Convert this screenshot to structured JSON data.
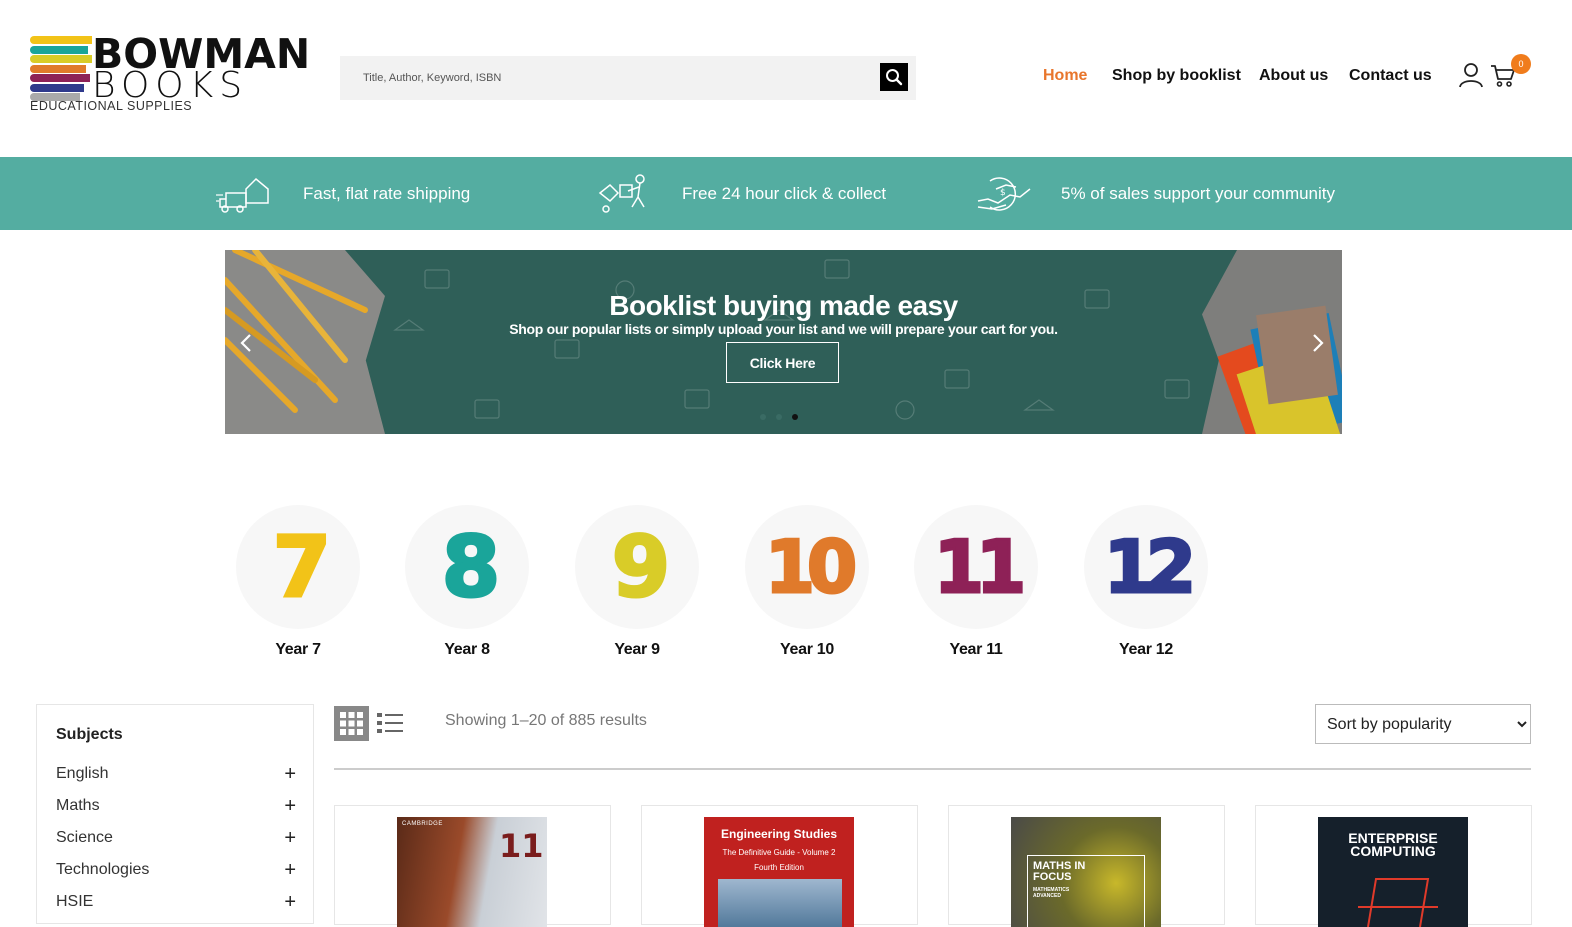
{
  "logo": {
    "word1": "BOWMAN",
    "word2": "BOOKS",
    "sub": "EDUCATIONAL SUPPLIES"
  },
  "search": {
    "placeholder": "Title, Author, Keyword, ISBN"
  },
  "nav": {
    "items": [
      "Home",
      "Shop by booklist",
      "About us",
      "Contact us"
    ],
    "active": "Home"
  },
  "cart": {
    "count": "0"
  },
  "features": [
    {
      "icon": "shipping-truck-icon",
      "text": "Fast, flat rate shipping"
    },
    {
      "icon": "click-collect-icon",
      "text": "Free 24 hour click & collect"
    },
    {
      "icon": "community-handshake-icon",
      "text": "5% of sales support your community"
    }
  ],
  "banner": {
    "title": "Booklist buying made easy",
    "subtitle": "Shop our popular lists or simply upload your list and we will prepare your cart for you.",
    "button": "Click Here",
    "slide_count": 3,
    "active_slide": 3
  },
  "years": [
    {
      "num": "7",
      "label": "Year 7",
      "color": "#f2c318"
    },
    {
      "num": "8",
      "label": "Year 8",
      "color": "#1aa59a"
    },
    {
      "num": "9",
      "label": "Year 9",
      "color": "#d9cc28"
    },
    {
      "num": "10",
      "label": "Year 10",
      "color": "#e07a2b"
    },
    {
      "num": "11",
      "label": "Year 11",
      "color": "#8e2157"
    },
    {
      "num": "12",
      "label": "Year 12",
      "color": "#2f3a8c"
    }
  ],
  "sidebar": {
    "title": "Subjects",
    "items": [
      "English",
      "Maths",
      "Science",
      "Technologies",
      "HSIE"
    ]
  },
  "toolbar": {
    "results": "Showing 1–20 of 885 results",
    "sort_selected": "Sort by popularity"
  },
  "products": [
    {
      "publisher": "CAMBRIDGE",
      "cover_text": "11",
      "cover_colors": [
        "#5a2a18",
        "#9a4a2a",
        "#c9cfd6"
      ]
    },
    {
      "cover_title": "Engineering Studies",
      "cover_line2": "The Definitive Guide - Volume 2",
      "cover_line3": "Fourth Edition",
      "cover_colors": [
        "#c0211f"
      ]
    },
    {
      "cover_title": "MATHS IN FOCUS",
      "cover_line2": "MATHEMATICS ADVANCED",
      "cover_colors": [
        "#a8a23a",
        "#555"
      ]
    },
    {
      "cover_title": "ENTERPRISE COMPUTING",
      "cover_colors": [
        "#15202b",
        "#e03a2a"
      ]
    }
  ],
  "colors": {
    "accent": "#e8762c",
    "teal": "#54ada1",
    "banner": "#2f5f58"
  }
}
